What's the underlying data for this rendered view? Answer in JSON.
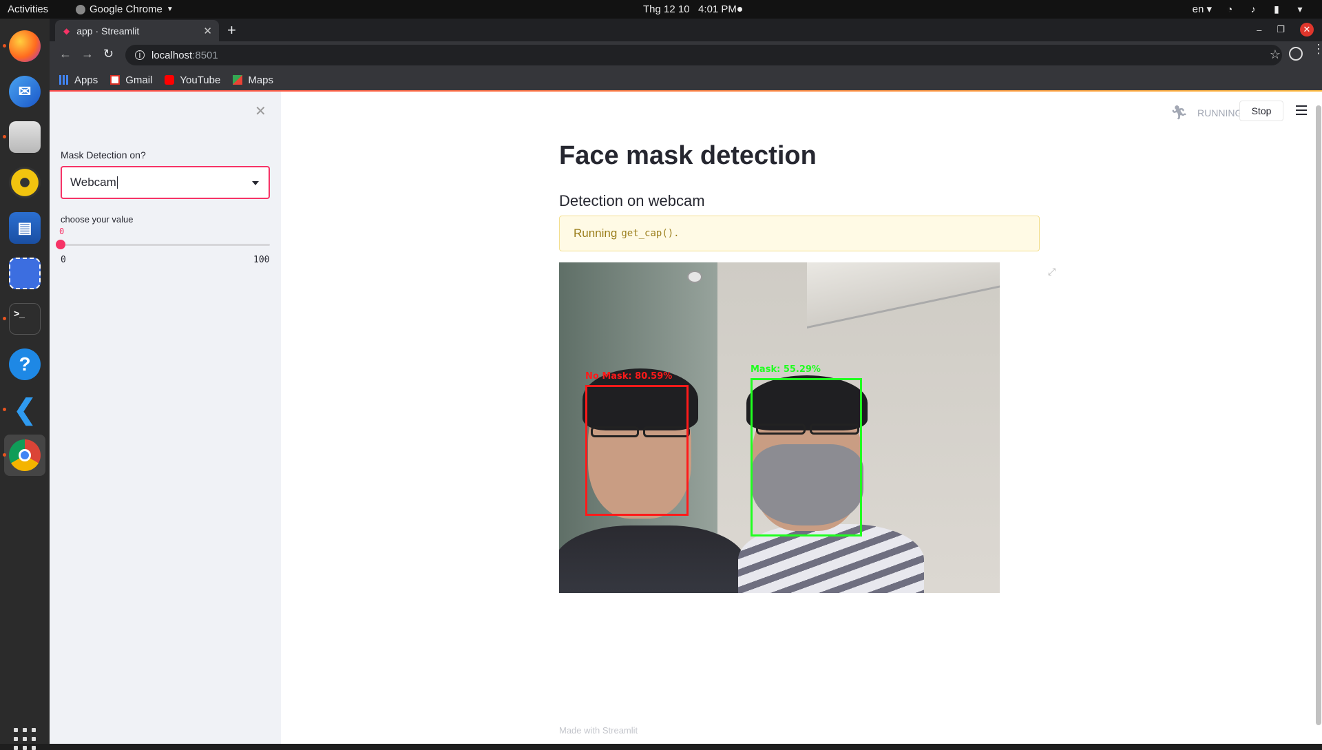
{
  "os": {
    "activities": "Activities",
    "app_menu": "Google Chrome",
    "clock": "Thg 12 10   4:01 PM",
    "language": "en"
  },
  "dock": {
    "items": [
      "firefox-icon",
      "thunderbird-icon",
      "files-icon",
      "rhythmbox-icon",
      "libreoffice-writer-icon",
      "screenshot-icon",
      "terminal-icon",
      "help-icon",
      "vscode-icon",
      "chrome-icon"
    ],
    "show_apps": "apps-grid-icon"
  },
  "browser": {
    "tab_title": "app · Streamlit",
    "url_host": "localhost",
    "url_port": ":8501",
    "bookmarks": [
      {
        "label": "Apps",
        "icon": "apps-icon"
      },
      {
        "label": "Gmail",
        "icon": "gmail-icon"
      },
      {
        "label": "YouTube",
        "icon": "youtube-icon"
      },
      {
        "label": "Maps",
        "icon": "maps-icon"
      }
    ]
  },
  "sidebar": {
    "select_label": "Mask Detection on?",
    "select_value": "Webcam",
    "slider_label": "choose your value",
    "slider_value": "0",
    "slider_value_num": 0,
    "slider_min": "0",
    "slider_max": "100"
  },
  "header": {
    "status": "RUNNING...",
    "stop_label": "Stop"
  },
  "main": {
    "title": "Face mask detection",
    "subheader": "Detection on webcam",
    "alert_prefix": "Running",
    "alert_code": "get_cap().",
    "detections": [
      {
        "label": "No Mask: 80.59%",
        "color": "#ff1a1a"
      },
      {
        "label": "Mask: 55.29%",
        "color": "#1fff1f"
      }
    ],
    "footer": "Made with Streamlit"
  },
  "colors": {
    "accent": "#f63366",
    "alert_bg": "#fffae5"
  }
}
